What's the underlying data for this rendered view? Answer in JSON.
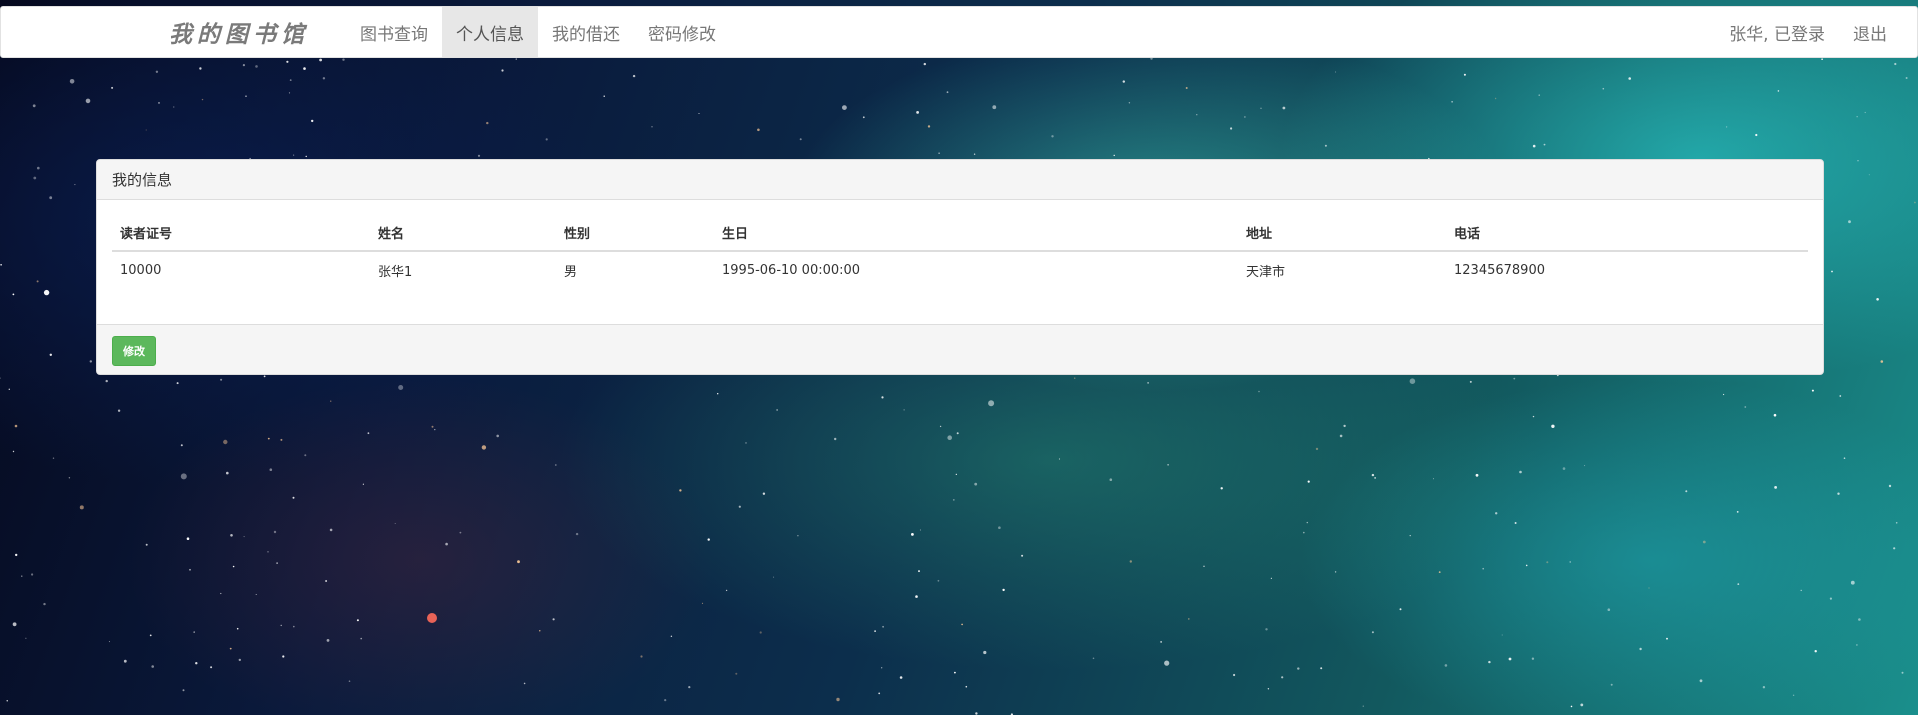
{
  "nav": {
    "brand": "我的图书馆",
    "items": [
      {
        "label": "图书查询",
        "active": false
      },
      {
        "label": "个人信息",
        "active": true
      },
      {
        "label": "我的借还",
        "active": false
      },
      {
        "label": "密码修改",
        "active": false
      }
    ],
    "user_status": "张华, 已登录",
    "logout": "退出"
  },
  "panel": {
    "title": "我的信息",
    "columns": [
      "读者证号",
      "姓名",
      "性别",
      "生日",
      "地址",
      "电话"
    ],
    "row": [
      "10000",
      "张华1",
      "男",
      "1995-06-10 00:00:00",
      "天津市",
      "12345678900"
    ],
    "edit_button": "修改"
  },
  "colors": {
    "button_green": "#5cb85c",
    "nav_active_bg": "#e7e7e7"
  }
}
